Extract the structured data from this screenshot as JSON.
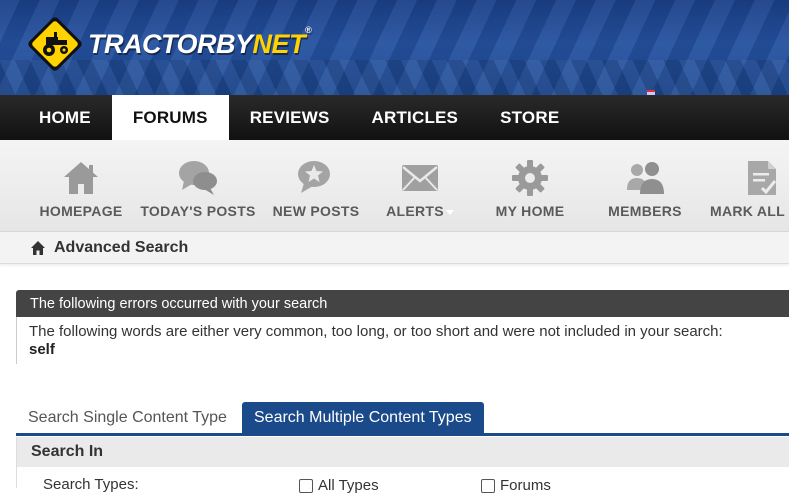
{
  "brand": {
    "name_part1": "TRACTORBY",
    "name_part2": "NET",
    "mark": "®"
  },
  "topnav": {
    "items": [
      {
        "label": "HOME",
        "active": false
      },
      {
        "label": "FORUMS",
        "active": true
      },
      {
        "label": "REVIEWS",
        "active": false
      },
      {
        "label": "ARTICLES",
        "active": false
      },
      {
        "label": "STORE",
        "active": false
      }
    ]
  },
  "subnav": {
    "items": [
      {
        "label": "HOMEPAGE",
        "icon": "house-icon"
      },
      {
        "label": "TODAY'S POSTS",
        "icon": "speech-bubbles-icon"
      },
      {
        "label": "NEW POSTS",
        "icon": "new-posts-bubble-icon"
      },
      {
        "label": "ALERTS",
        "icon": "envelope-icon"
      },
      {
        "label": "MY HOME",
        "icon": "gear-icon"
      },
      {
        "label": "MEMBERS",
        "icon": "members-icon"
      },
      {
        "label": "MARK ALL R",
        "icon": "document-check-icon"
      }
    ]
  },
  "breadcrumb": {
    "title": "Advanced Search"
  },
  "error": {
    "heading": "The following errors occurred with your search",
    "message": "The following words are either very common, too long, or too short and were not included in your search:",
    "word": "self"
  },
  "tabs": [
    {
      "label": "Search Single Content Type",
      "active": false
    },
    {
      "label": "Search Multiple Content Types",
      "active": true
    }
  ],
  "search_panel": {
    "heading": "Search In",
    "row_label": "Search Types:",
    "options": [
      "All Types",
      "Forums"
    ]
  },
  "colors": {
    "banner": "#1e4a95",
    "accent": "#1b4a8a",
    "logo_yellow": "#ffd200"
  }
}
